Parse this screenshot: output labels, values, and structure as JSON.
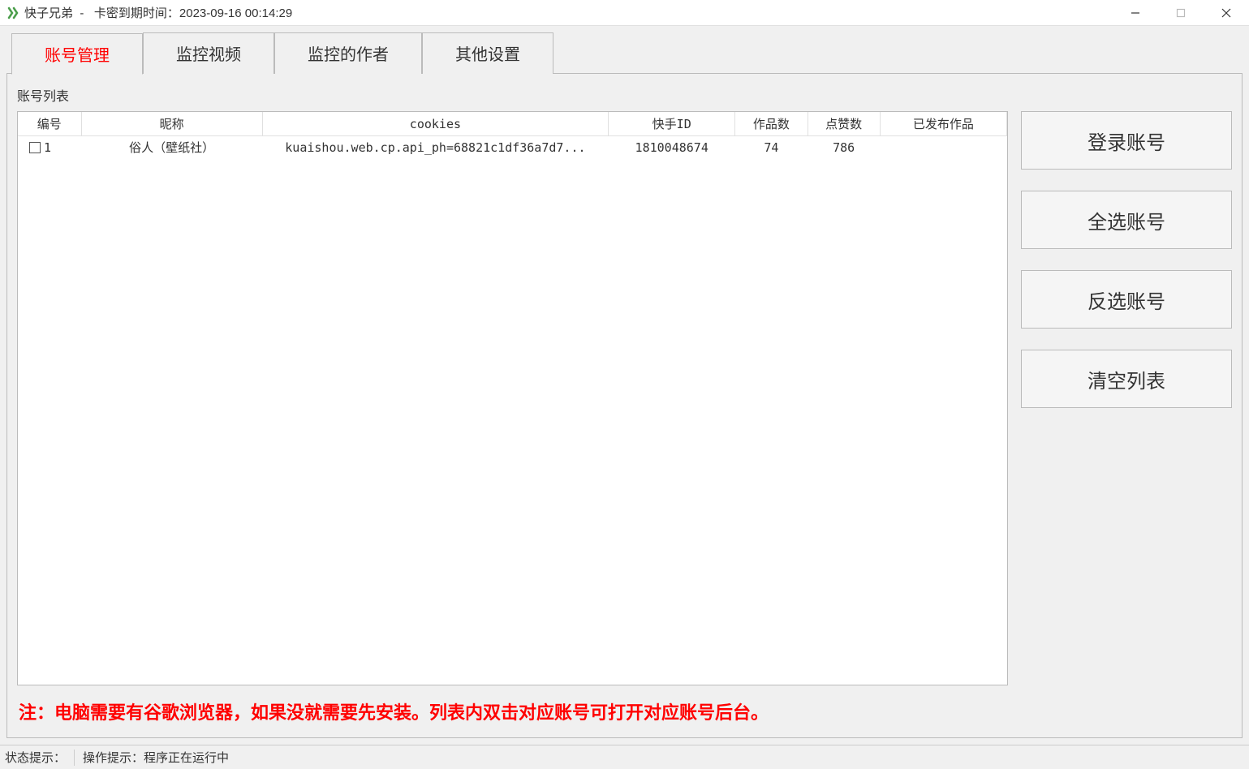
{
  "titlebar": {
    "app_name": "快子兄弟",
    "separator": "-",
    "expire_label": "卡密到期时间：",
    "expire_value": "2023-09-16 00:14:29"
  },
  "tabs": [
    {
      "label": "账号管理",
      "active": true
    },
    {
      "label": "监控视频",
      "active": false
    },
    {
      "label": "监控的作者",
      "active": false
    },
    {
      "label": "其他设置",
      "active": false
    }
  ],
  "group_label": "账号列表",
  "table": {
    "headers": {
      "num": "编号",
      "nick": "昵称",
      "cookies": "cookies",
      "id": "快手ID",
      "works": "作品数",
      "likes": "点赞数",
      "published": "已发布作品"
    },
    "rows": [
      {
        "num": "1",
        "nick": "俗人（壁纸社）",
        "cookies": "kuaishou.web.cp.api_ph=68821c1df36a7d7...",
        "id": "1810048674",
        "works": "74",
        "likes": "786",
        "published": ""
      }
    ]
  },
  "buttons": {
    "login": "登录账号",
    "select_all": "全选账号",
    "invert": "反选账号",
    "clear": "清空列表"
  },
  "note": "注：电脑需要有谷歌浏览器，如果没就需要先安装。列表内双击对应账号可打开对应账号后台。",
  "statusbar": {
    "state_label": "状态提示：",
    "op_label": "操作提示：",
    "op_text": "程序正在运行中"
  }
}
